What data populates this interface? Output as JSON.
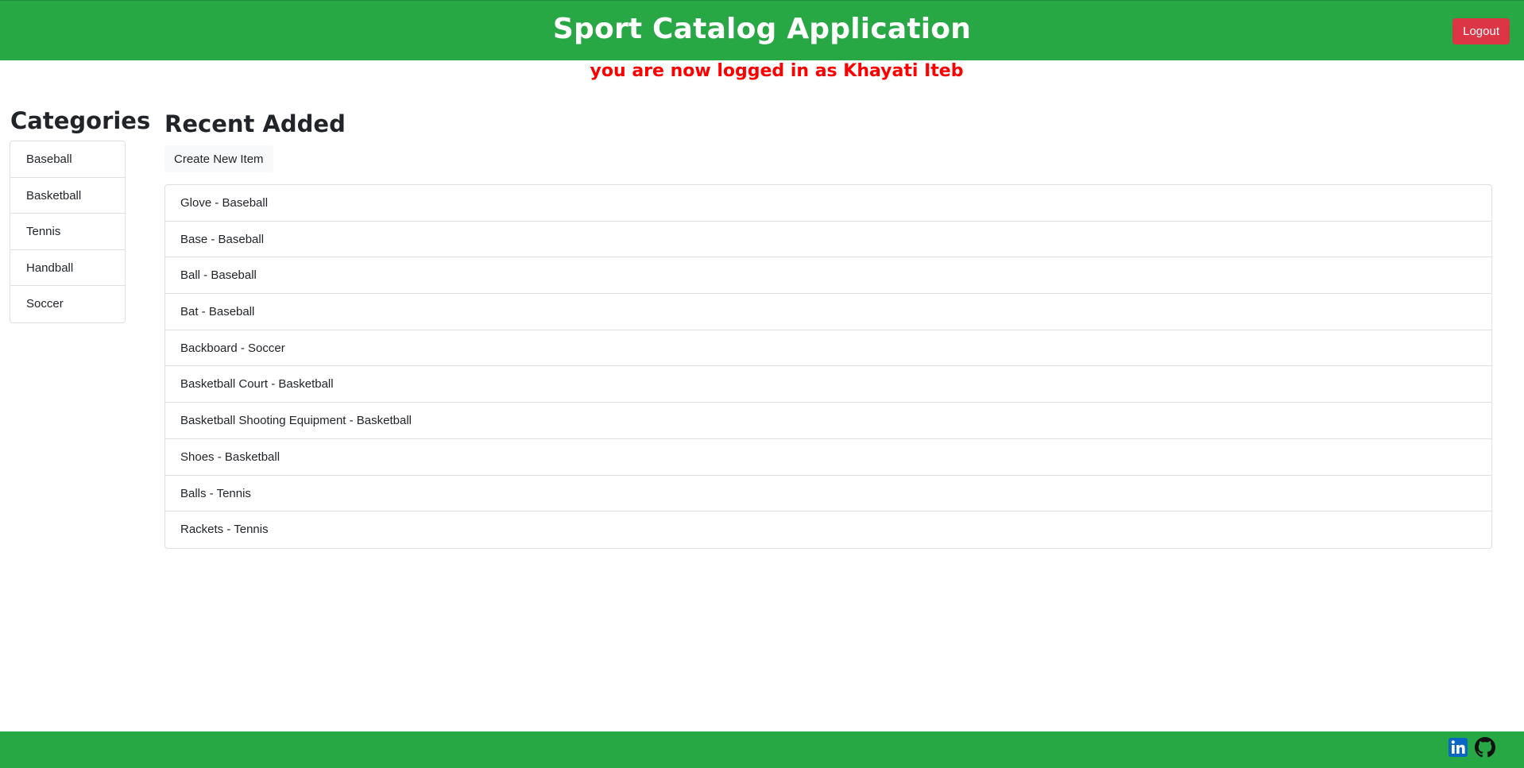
{
  "header": {
    "title": "Sport Catalog Application",
    "logout_label": "Logout"
  },
  "flash_message": "you are now logged in as Khayati Iteb",
  "sidebar": {
    "heading": "Categories",
    "items": [
      {
        "label": "Baseball"
      },
      {
        "label": "Basketball"
      },
      {
        "label": "Tennis"
      },
      {
        "label": "Handball"
      },
      {
        "label": "Soccer"
      }
    ]
  },
  "main": {
    "heading": "Recent Added",
    "create_label": "Create New Item",
    "items": [
      {
        "label": "Glove - Baseball"
      },
      {
        "label": "Base - Baseball"
      },
      {
        "label": "Ball - Baseball"
      },
      {
        "label": "Bat - Baseball"
      },
      {
        "label": "Backboard - Soccer"
      },
      {
        "label": "Basketball Court - Basketball"
      },
      {
        "label": "Basketball Shooting Equipment - Basketball"
      },
      {
        "label": "Shoes - Basketball"
      },
      {
        "label": "Balls - Tennis"
      },
      {
        "label": "Rackets - Tennis"
      }
    ]
  },
  "footer": {
    "icons": [
      "linkedin-icon",
      "github-icon"
    ]
  },
  "colors": {
    "brand_green": "#28a745",
    "danger_red": "#dc3545",
    "flash_red": "#ff0000",
    "linkedin_blue": "#0a66c2"
  }
}
